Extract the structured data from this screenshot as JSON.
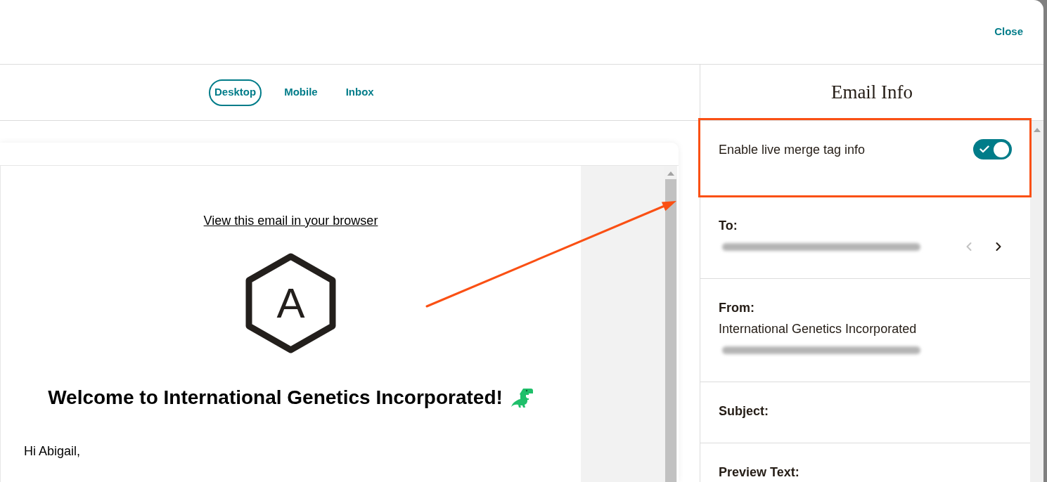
{
  "header": {
    "close_label": "Close"
  },
  "preview": {
    "tabs": [
      {
        "label": "Desktop",
        "selected": true
      },
      {
        "label": "Mobile",
        "selected": false
      },
      {
        "label": "Inbox",
        "selected": false
      }
    ],
    "email": {
      "browser_link": "View this email in your browser",
      "logo_letter": "A",
      "heading": "Welcome to International Genetics Incorporated!",
      "greeting": "Hi Abigail,"
    }
  },
  "email_info": {
    "title": "Email Info",
    "merge_tag_toggle": {
      "label": "Enable live merge tag info",
      "on": true
    },
    "fields": [
      {
        "label": "To:",
        "redacted": true,
        "pager": {
          "prev_disabled": true,
          "next_disabled": false
        }
      },
      {
        "label": "From:",
        "value": "International Genetics Incorporated",
        "redacted": true
      },
      {
        "label": "Subject:"
      },
      {
        "label": "Preview Text:"
      }
    ]
  }
}
